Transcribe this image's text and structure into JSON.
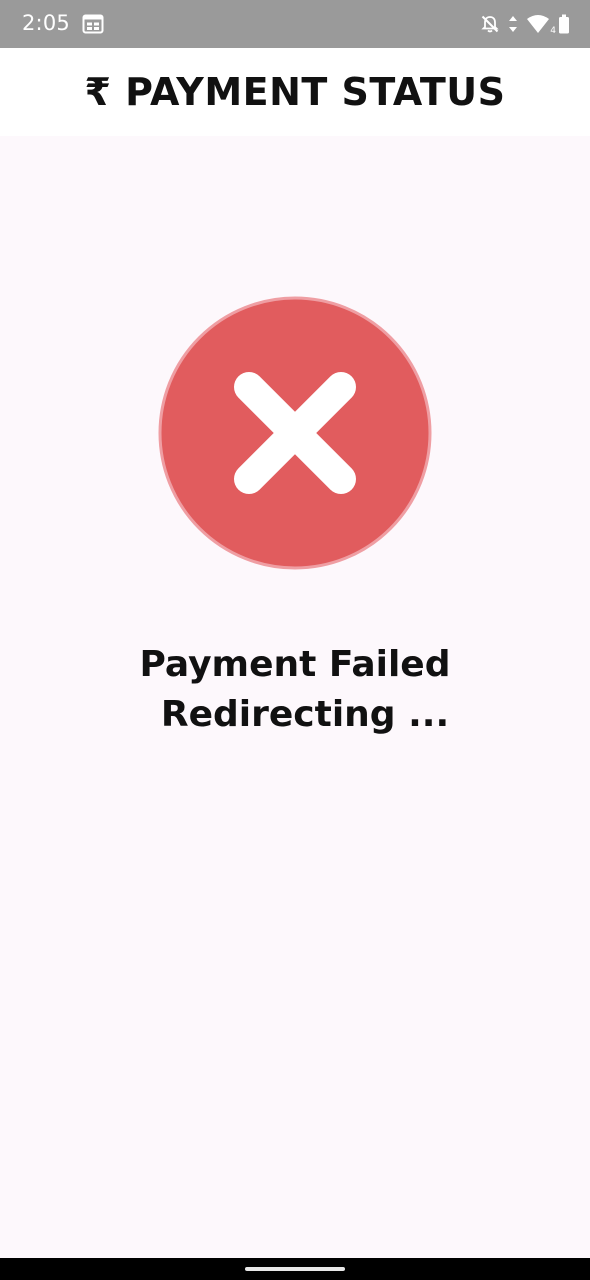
{
  "status_bar": {
    "time": "2:05",
    "icons": [
      "calendar-app-icon",
      "notifications-off-icon",
      "data-arrows-icon",
      "wifi-icon",
      "battery-icon"
    ],
    "wifi_badge": "4",
    "background": "#9a9a9a"
  },
  "header": {
    "title": "₹ PAYMENT STATUS"
  },
  "status": {
    "icon": "close-icon",
    "icon_color": "#e15c5e",
    "line1": "Payment Failed",
    "line2": "Redirecting ..."
  },
  "colors": {
    "background": "#fdf8fc",
    "header_background": "#ffffff",
    "text": "#111111"
  }
}
